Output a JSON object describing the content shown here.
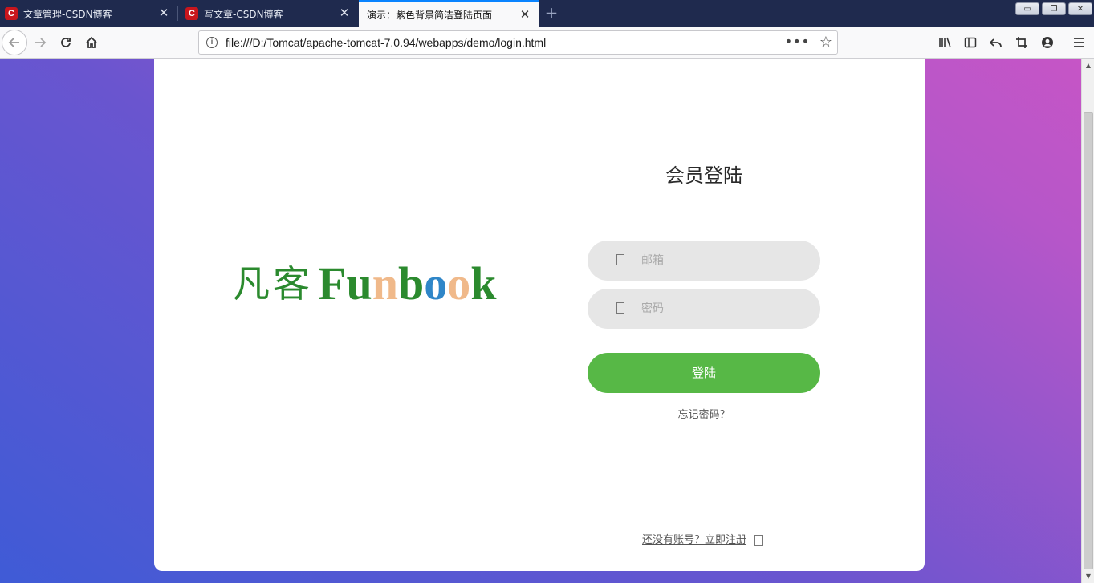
{
  "browser": {
    "tabs": [
      {
        "title": "文章管理-CSDN博客",
        "favicon": "C"
      },
      {
        "title": "写文章-CSDN博客",
        "favicon": "C"
      },
      {
        "title": "演示：紫色背景简洁登陆页面",
        "active": true
      }
    ],
    "url": "file:///D:/Tomcat/apache-tomcat-7.0.94/webapps/demo/login.html",
    "new_tab_symbol": "+",
    "page_actions_symbol": "•••",
    "bookmark_symbol": "☆"
  },
  "page": {
    "logo": {
      "chinese": "凡客",
      "letters": [
        {
          "char": "F",
          "color": "#2b8a2e"
        },
        {
          "char": "u",
          "color": "#2b8a2e"
        },
        {
          "char": "n",
          "color": "#f0b98a"
        },
        {
          "char": "b",
          "color": "#2b8a2e"
        },
        {
          "char": "o",
          "color": "#2f86c8"
        },
        {
          "char": "o",
          "color": "#f0b98a"
        },
        {
          "char": "k",
          "color": "#2b8a2e"
        }
      ]
    },
    "title": "会员登陆",
    "email_placeholder": "邮箱",
    "password_placeholder": "密码",
    "login_button": "登陆",
    "forgot_link": "忘记密码？",
    "register_link": "还没有账号？立即注册"
  },
  "colors": {
    "accent_button": "#57b846",
    "background_gradient_start": "#3f5bd6",
    "background_gradient_end": "#c655c6",
    "field_background": "#e6e6e6"
  }
}
